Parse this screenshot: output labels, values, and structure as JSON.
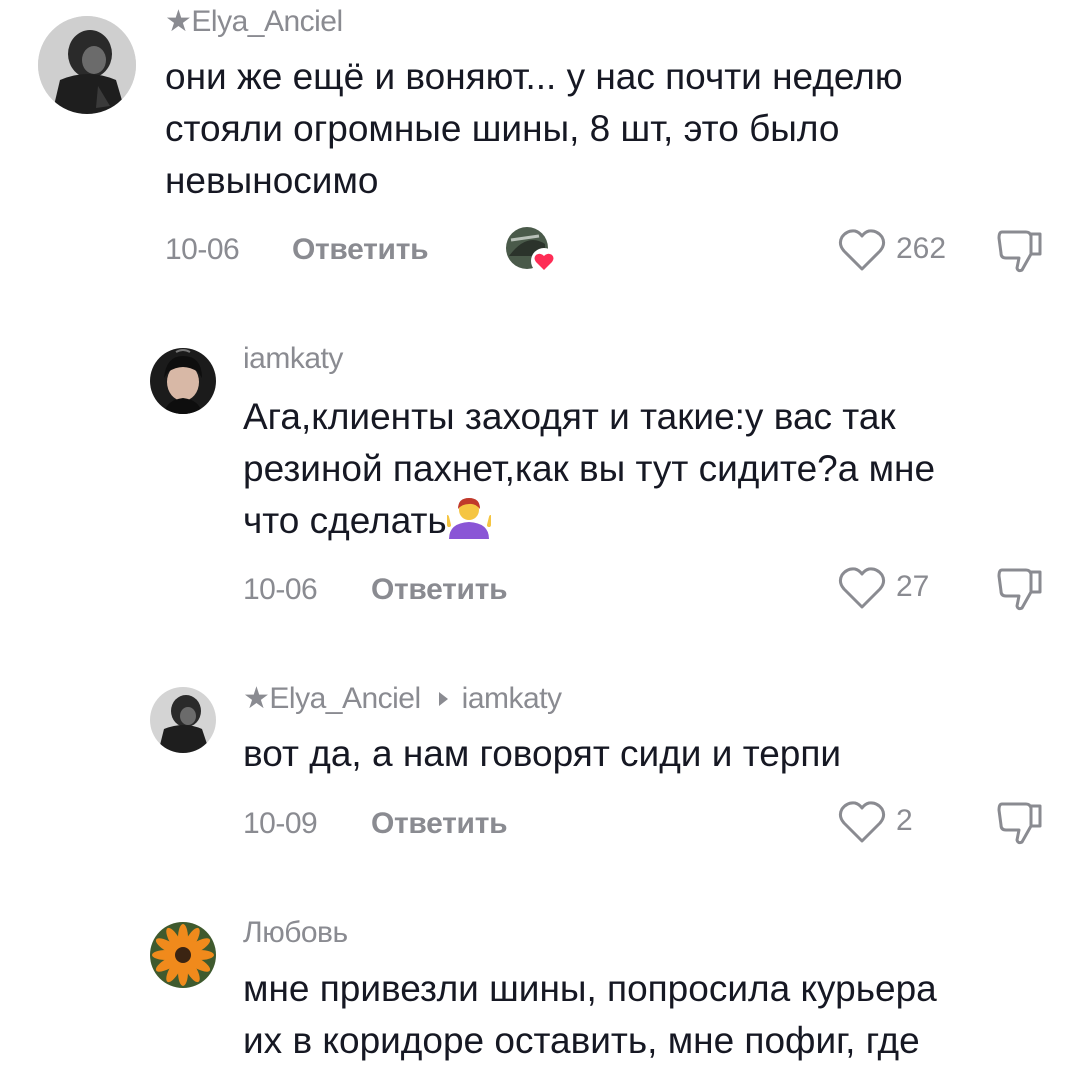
{
  "comments": [
    {
      "username": "★Elya_Anciel",
      "lines": [
        "они же ещё и воняют... у нас почти неделю",
        "стояли огромные шины, 8 шт, это было",
        "невыносимо"
      ],
      "date": "10-06",
      "reply_label": "Ответить",
      "likes": "262"
    },
    {
      "username": "iamkaty",
      "lines": [
        "Ага,клиенты заходят и такие:у вас так",
        "резиной пахнет,как вы тут сидите?а мне",
        "что сделать"
      ],
      "date": "10-06",
      "reply_label": "Ответить",
      "likes": "27"
    },
    {
      "username": "★Elya_Anciel",
      "reply_to": "iamkaty",
      "lines": [
        "вот да, а нам говорят сиди и терпи"
      ],
      "date": "10-09",
      "reply_label": "Ответить",
      "likes": "2"
    },
    {
      "username": "Любовь",
      "lines": [
        "мне привезли шины, попросила курьера",
        "их в коридоре оставить, мне пофиг, где"
      ]
    }
  ],
  "icons": {
    "like": "heart-outline-icon",
    "dislike": "thumbs-down-icon",
    "creator_liked": "creator-liked-badge-icon",
    "emoji": "person-shrugging-emoji"
  },
  "colors": {
    "text": "#161823",
    "muted": "#8a8b91",
    "heart_badge": "#fe2c55"
  }
}
